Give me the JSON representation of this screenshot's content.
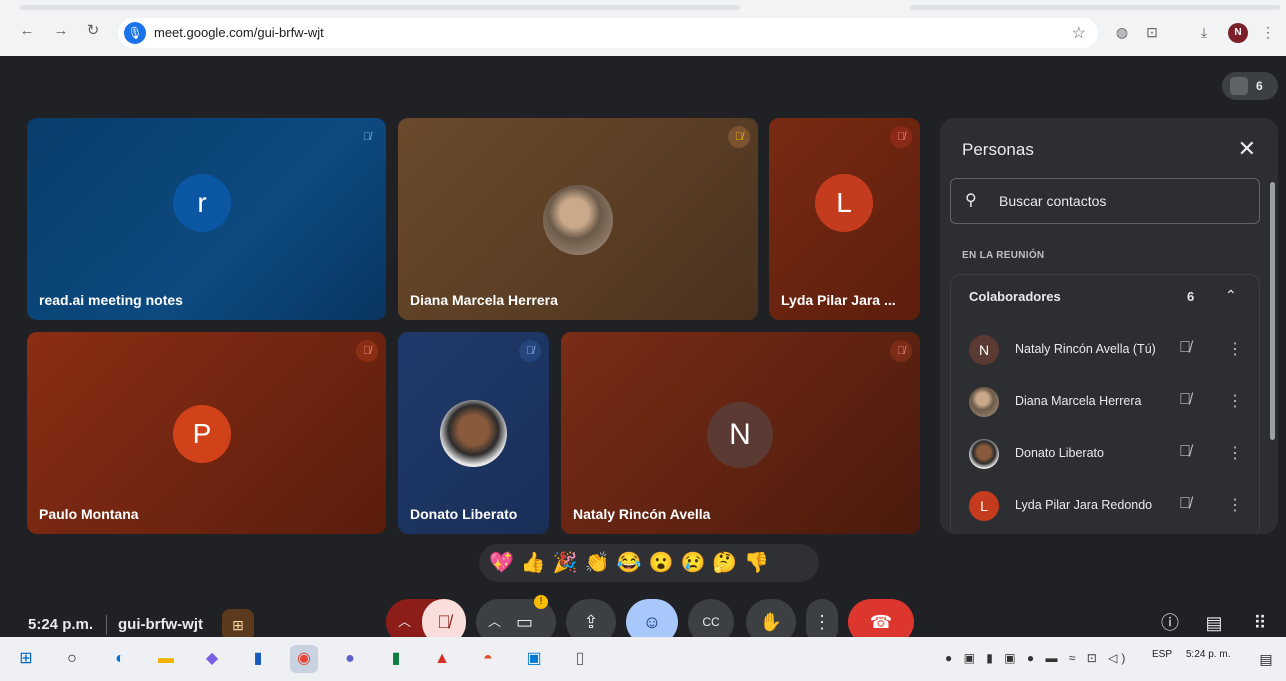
{
  "browser": {
    "url": "meet.google.com/gui-brfw-wjt",
    "profile_initial": "N"
  },
  "meet": {
    "participant_count": "6",
    "tiles": [
      {
        "name": "read.ai meeting notes",
        "initial": "r",
        "color": "#0b57a3"
      },
      {
        "name": "Diana Marcela Herrera",
        "initial": ""
      },
      {
        "name": "Lyda Pilar Jara ...",
        "initial": "L",
        "color": "#c53b1e"
      },
      {
        "name": "Paulo Montana",
        "initial": "P",
        "color": "#d2421a"
      },
      {
        "name": "Donato Liberato",
        "initial": ""
      },
      {
        "name": "Nataly Rincón Avella",
        "initial": "N",
        "color": "#5a3a33"
      }
    ],
    "reactions": [
      "💖",
      "👍",
      "🎉",
      "👏",
      "😂",
      "😮",
      "😢",
      "🤔",
      "👎"
    ],
    "time": "5:24 p.m.",
    "meeting_code": "gui-brfw-wjt"
  },
  "panel": {
    "title": "Personas",
    "search_placeholder": "Buscar contactos",
    "section_label": "EN LA REUNIÓN",
    "group_label": "Colaboradores",
    "group_count": "6",
    "people": [
      {
        "name": "Nataly Rincón Avella (Tú)",
        "initial": "N",
        "color": "#5a3a33"
      },
      {
        "name": "Diana Marcela Herrera",
        "initial": ""
      },
      {
        "name": "Donato Liberato",
        "initial": ""
      },
      {
        "name": "Lyda Pilar Jara Redondo",
        "initial": "L",
        "color": "#c53b1e"
      }
    ]
  },
  "taskbar": {
    "lang": "ESP",
    "clock": "5:24 p. m."
  }
}
